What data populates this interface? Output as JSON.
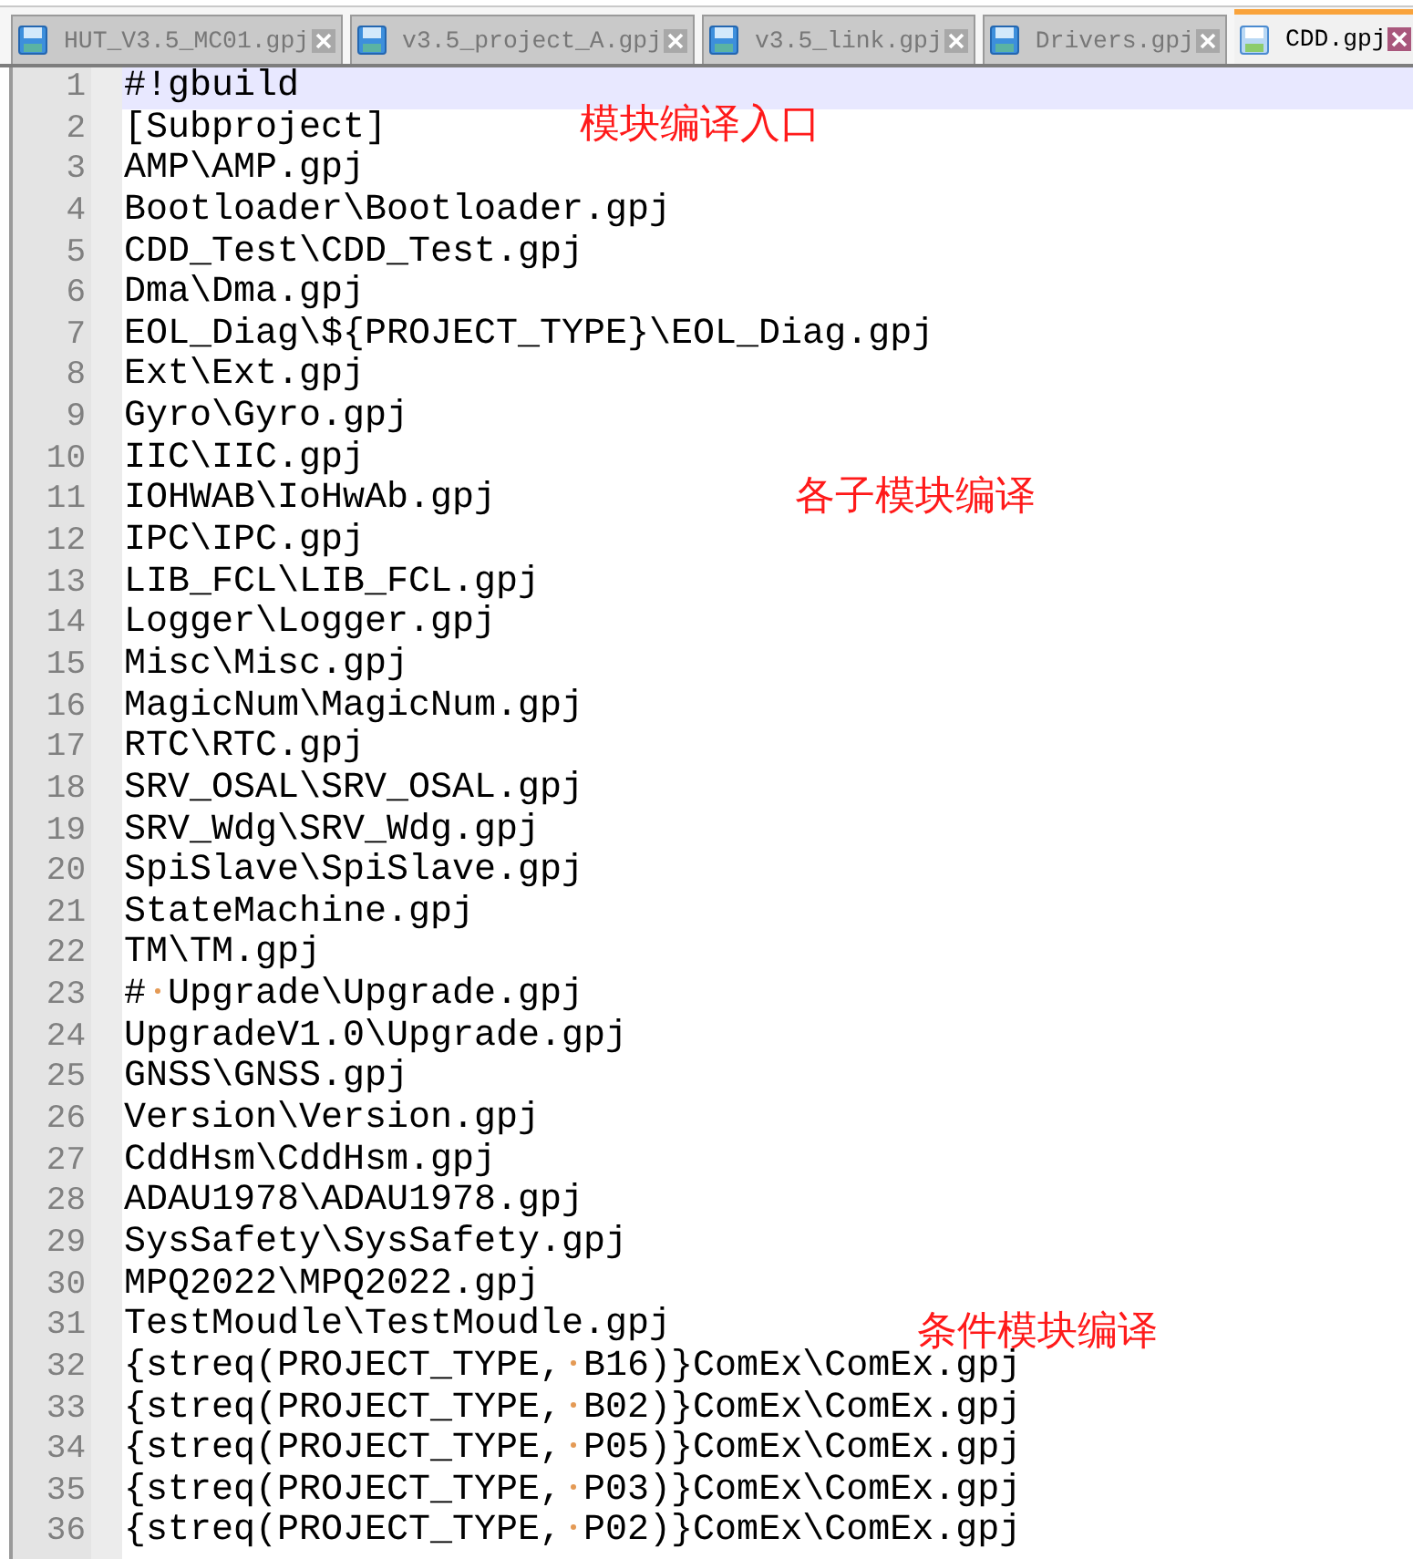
{
  "tabs": [
    {
      "title": "HUT_V3.5_MC01.gpj",
      "selected": false
    },
    {
      "title": "v3.5_project_A.gpj",
      "selected": false
    },
    {
      "title": "v3.5_link.gpj",
      "selected": false
    },
    {
      "title": "Drivers.gpj",
      "selected": false
    },
    {
      "title": "CDD.gpj",
      "selected": true
    }
  ],
  "editor": {
    "lines": [
      {
        "number": "1",
        "text": "#!gbuild",
        "current": true
      },
      {
        "number": "2",
        "text": "[Subproject]",
        "current": false,
        "annotation": "模块编译入口"
      },
      {
        "number": "3",
        "text": "AMP\\AMP.gpj",
        "current": false
      },
      {
        "number": "4",
        "text": "Bootloader\\Bootloader.gpj",
        "current": false
      },
      {
        "number": "5",
        "text": "CDD_Test\\CDD_Test.gpj",
        "current": false
      },
      {
        "number": "6",
        "text": "Dma\\Dma.gpj",
        "current": false
      },
      {
        "number": "7",
        "text": "EOL_Diag\\${PROJECT_TYPE}\\EOL_Diag.gpj",
        "current": false
      },
      {
        "number": "8",
        "text": "Ext\\Ext.gpj",
        "current": false
      },
      {
        "number": "9",
        "text": "Gyro\\Gyro.gpj",
        "current": false
      },
      {
        "number": "10",
        "text": "IIC\\IIC.gpj",
        "current": false
      },
      {
        "number": "11",
        "text": "IOHWAB\\IoHwAb.gpj",
        "current": false,
        "annotation": "各子模块编译"
      },
      {
        "number": "12",
        "text": "IPC\\IPC.gpj",
        "current": false
      },
      {
        "number": "13",
        "text": "LIB_FCL\\LIB_FCL.gpj",
        "current": false
      },
      {
        "number": "14",
        "text": "Logger\\Logger.gpj",
        "current": false
      },
      {
        "number": "15",
        "text": "Misc\\Misc.gpj",
        "current": false
      },
      {
        "number": "16",
        "text": "MagicNum\\MagicNum.gpj",
        "current": false
      },
      {
        "number": "17",
        "text": "RTC\\RTC.gpj",
        "current": false
      },
      {
        "number": "18",
        "text": "SRV_OSAL\\SRV_OSAL.gpj",
        "current": false
      },
      {
        "number": "19",
        "text": "SRV_Wdg\\SRV_Wdg.gpj",
        "current": false
      },
      {
        "number": "20",
        "text": "SpiSlave\\SpiSlave.gpj",
        "current": false
      },
      {
        "number": "21",
        "text": "StateMachine.gpj",
        "current": false
      },
      {
        "number": "22",
        "text": "TM\\TM.gpj",
        "current": false
      },
      {
        "number": "23",
        "text": "# Upgrade\\Upgrade.gpj",
        "current": false
      },
      {
        "number": "24",
        "text": "UpgradeV1.0\\Upgrade.gpj",
        "current": false
      },
      {
        "number": "25",
        "text": "GNSS\\GNSS.gpj",
        "current": false
      },
      {
        "number": "26",
        "text": "Version\\Version.gpj",
        "current": false
      },
      {
        "number": "27",
        "text": "CddHsm\\CddHsm.gpj",
        "current": false
      },
      {
        "number": "28",
        "text": "ADAU1978\\ADAU1978.gpj",
        "current": false
      },
      {
        "number": "29",
        "text": "SysSafety\\SysSafety.gpj",
        "current": false
      },
      {
        "number": "30",
        "text": "MPQ2022\\MPQ2022.gpj",
        "current": false
      },
      {
        "number": "31",
        "text": "TestMoudle\\TestMoudle.gpj",
        "current": false,
        "annotation": "条件模块编译"
      },
      {
        "number": "32",
        "text": "{streq(PROJECT_TYPE, B16)}ComEx\\ComEx.gpj",
        "current": false
      },
      {
        "number": "33",
        "text": "{streq(PROJECT_TYPE, B02)}ComEx\\ComEx.gpj",
        "current": false
      },
      {
        "number": "34",
        "text": "{streq(PROJECT_TYPE, P05)}ComEx\\ComEx.gpj",
        "current": false
      },
      {
        "number": "35",
        "text": "{streq(PROJECT_TYPE, P03)}ComEx\\ComEx.gpj",
        "current": false
      },
      {
        "number": "36",
        "text": "{streq(PROJECT_TYPE, P02)}ComEx\\ComEx.gpj",
        "current": false
      }
    ]
  }
}
